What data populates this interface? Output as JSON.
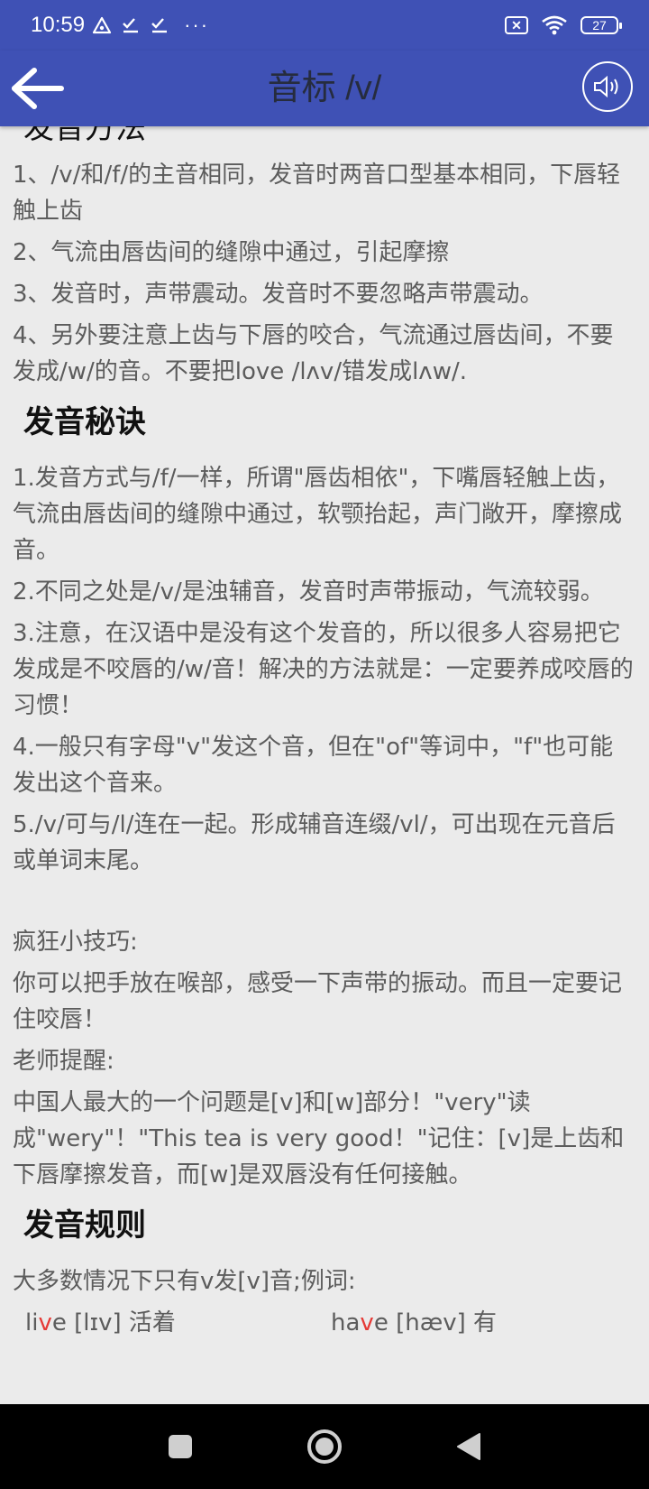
{
  "status": {
    "time": "10:59",
    "battery": "27",
    "dots": "···"
  },
  "appbar": {
    "title": "音标 /v/"
  },
  "section1": {
    "title": "发音方法",
    "items": [
      "1、/v/和/f/的主音相同，发音时两音口型基本相同，下唇轻触上齿",
      "2、气流由唇齿间的缝隙中通过，引起摩擦",
      "3、发音时，声带震动。发音时不要忽略声带震动。",
      "4、另外要注意上齿与下唇的咬合，气流通过唇齿间，不要发成/w/的音。不要把love /lʌv/错发成lʌw/."
    ]
  },
  "section2": {
    "title": "发音秘诀",
    "items": [
      "1.发音方式与/f/一样，所谓\"唇齿相依\"，下嘴唇轻触上齿，气流由唇齿间的缝隙中通过，软颚抬起，声门敞开，摩擦成音。",
      "2.不同之处是/v/是浊辅音，发音时声带振动，气流较弱。",
      "3.注意，在汉语中是没有这个发音的，所以很多人容易把它发成是不咬唇的/w/音！解决的方法就是：一定要养成咬唇的习惯！",
      "4.一般只有字母\"v\"发这个音，但在\"of\"等词中，\"f\"也可能发出这个音来。",
      "5./v/可与/l/连在一起。形成辅音连缀/vl/，可出现在元音后或单词末尾。"
    ],
    "tips_label": "疯狂小技巧:",
    "tips_text": "你可以把手放在喉部，感受一下声带的振动。而且一定要记住咬唇！",
    "teacher_label": "老师提醒:",
    "teacher_text": "中国人最大的一个问题是[v]和[w]部分！\"very\"读成\"wery\"！\"This tea is very good！\"记住：[v]是上齿和下唇摩擦发音，而[w]是双唇没有任何接触。"
  },
  "section3": {
    "title": "发音规则",
    "rule": "大多数情况下只有v发[v]音;例词:",
    "examples": [
      {
        "pre": "li",
        "hl": "v",
        "post": "e [lɪv] 活着"
      },
      {
        "pre": "ha",
        "hl": "v",
        "post": "e [hæv] 有"
      }
    ]
  },
  "colors": {
    "primary": "#3f51b5",
    "highlight": "#e53935",
    "background": "#ebebeb"
  },
  "icons": [
    "back-arrow-icon",
    "speaker-icon",
    "wifi-icon",
    "battery-icon",
    "nav-square-icon",
    "nav-circle-icon",
    "nav-triangle-icon"
  ]
}
